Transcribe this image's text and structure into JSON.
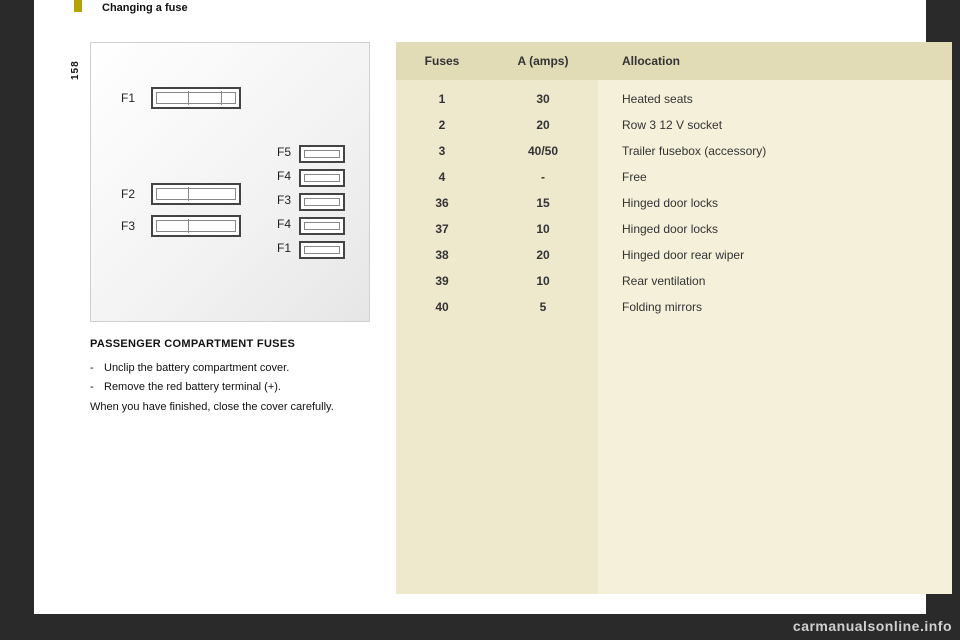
{
  "page_number": "158",
  "header": "Changing a fuse",
  "section_title": "PASSENGER COMPARTMENT FUSES",
  "instructions": {
    "bullet_1": "Unclip the battery compartment cover.",
    "bullet_2": "Remove the red battery terminal (+).",
    "closing": "When you have finished, close the cover carefully."
  },
  "diagram_labels": {
    "left_1": "F1",
    "left_2": "F2",
    "left_3": "F3",
    "right_1": "F5",
    "right_2": "F4",
    "right_3": "F3",
    "right_4": "F4",
    "right_5": "F1"
  },
  "table": {
    "headers": {
      "fuses": "Fuses",
      "amps": "A (amps)",
      "allocation": "Allocation"
    },
    "rows": [
      {
        "f": "1",
        "a": "30",
        "alloc": "Heated seats"
      },
      {
        "f": "2",
        "a": "20",
        "alloc": "Row 3 12 V socket"
      },
      {
        "f": "3",
        "a": "40/50",
        "alloc": "Trailer fusebox (accessory)"
      },
      {
        "f": "4",
        "a": "-",
        "alloc": "Free"
      },
      {
        "f": "36",
        "a": "15",
        "alloc": "Hinged door locks"
      },
      {
        "f": "37",
        "a": "10",
        "alloc": "Hinged door locks"
      },
      {
        "f": "38",
        "a": "20",
        "alloc": "Hinged door rear wiper"
      },
      {
        "f": "39",
        "a": "10",
        "alloc": "Rear ventilation"
      },
      {
        "f": "40",
        "a": "5",
        "alloc": "Folding mirrors"
      }
    ]
  },
  "watermark": "carmanualsonline.info"
}
